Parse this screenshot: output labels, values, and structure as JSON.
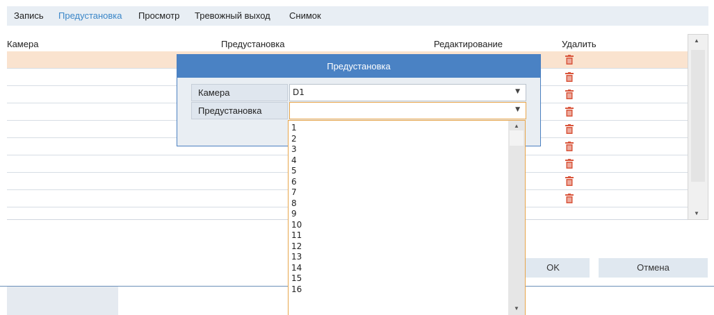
{
  "tabs": [
    "Запись",
    "Предустановка",
    "Просмотр",
    "Тревожный выход",
    "Снимок"
  ],
  "table": {
    "headers": [
      "Камера",
      "Предустановка",
      "Редактирование",
      "Удалить"
    ],
    "row_count": 9
  },
  "icons": {
    "delete": "trash-icon",
    "scroll_up": "arrow-up-icon",
    "scroll_down": "arrow-down-icon",
    "dropdown": "chevron-down-icon"
  },
  "colors": {
    "accent": "#4a82c4",
    "selected_row": "#fae3cf",
    "trash": "#d9553b",
    "focus": "#e8a54a"
  },
  "dialog": {
    "title": "Предустановка",
    "camera_label": "Камера",
    "camera_value": "D1",
    "preset_label": "Предустановка",
    "preset_value": ""
  },
  "preset_options": [
    "1",
    "2",
    "3",
    "4",
    "5",
    "6",
    "7",
    "8",
    "9",
    "10",
    "11",
    "12",
    "13",
    "14",
    "15",
    "16"
  ],
  "buttons": {
    "ok": "OK",
    "cancel": "Отмена"
  }
}
